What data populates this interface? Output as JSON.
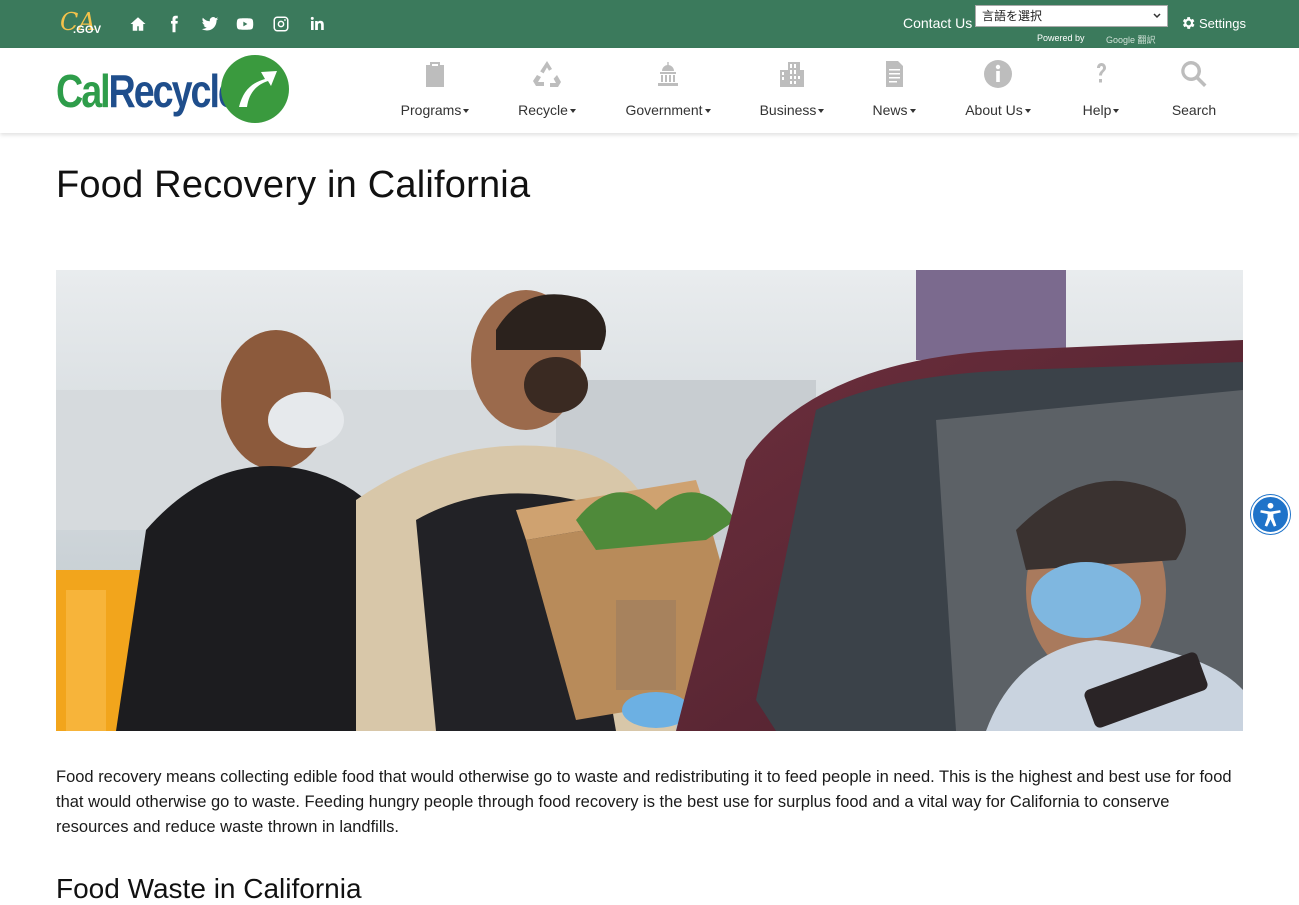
{
  "topbar": {
    "cagov_logo": {
      "ca": "CA",
      "gov": ".GOV"
    },
    "social_icons": [
      "home-icon",
      "facebook-icon",
      "twitter-icon",
      "youtube-icon",
      "instagram-icon",
      "linkedin-icon"
    ],
    "contact_label": "Contact Us",
    "language_select": "言語を選択",
    "powered_by": "Powered by",
    "google_translate": "Google 翻訳",
    "settings_label": "Settings"
  },
  "header": {
    "logo_cal": "Cal",
    "logo_recycle": "Recycle",
    "nav": [
      {
        "label": "Programs",
        "icon": "clipboard-icon",
        "dropdown": true
      },
      {
        "label": "Recycle",
        "icon": "recycle-icon",
        "dropdown": true
      },
      {
        "label": "Government",
        "icon": "capitol-icon",
        "dropdown": true
      },
      {
        "label": "Business",
        "icon": "building-icon",
        "dropdown": true
      },
      {
        "label": "News",
        "icon": "document-icon",
        "dropdown": true
      },
      {
        "label": "About Us",
        "icon": "info-icon",
        "dropdown": true
      },
      {
        "label": "Help",
        "icon": "question-icon",
        "dropdown": true
      },
      {
        "label": "Search",
        "icon": "search-icon",
        "dropdown": false
      }
    ]
  },
  "main": {
    "title": "Food Recovery in California",
    "intro": "Food recovery means collecting edible food that would otherwise go to waste and redistributing it to feed people in need. This is the highest and best use for food that would otherwise go to waste. Feeding hungry people through food recovery is the best use for surplus food and a vital way for California to conserve resources and reduce waste thrown in landfills.",
    "next_heading": "Food Waste in California"
  },
  "colors": {
    "topbar": "#3b7a5c",
    "logo_green": "#2e9d4a",
    "logo_blue": "#1f4e8c",
    "accessibility_blue": "#1f73c9"
  }
}
